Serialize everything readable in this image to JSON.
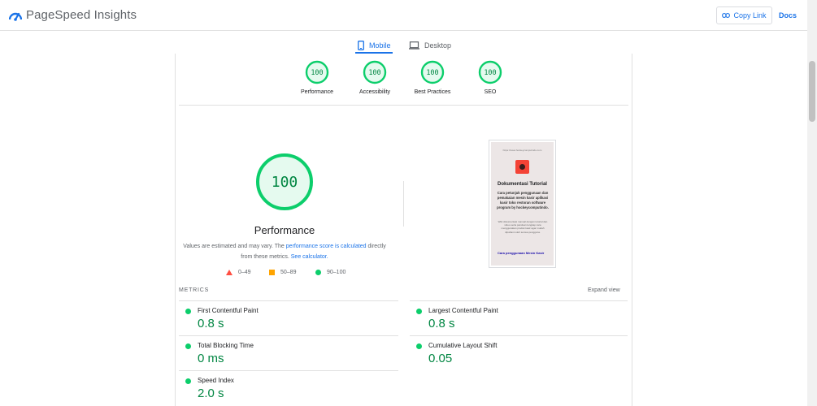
{
  "header": {
    "title": "PageSpeed Insights",
    "copy_link_label": "Copy Link",
    "docs_label": "Docs"
  },
  "tabs": [
    {
      "label": "Mobile",
      "active": true
    },
    {
      "label": "Desktop",
      "active": false
    }
  ],
  "category_scores": [
    {
      "label": "Performance",
      "score": "100"
    },
    {
      "label": "Accessibility",
      "score": "100"
    },
    {
      "label": "Best Practices",
      "score": "100"
    },
    {
      "label": "SEO",
      "score": "100"
    }
  ],
  "performance": {
    "score": "100",
    "title": "Performance",
    "desc_prefix": "Values are estimated and may vary. The ",
    "desc_link1": "performance score is calculated",
    "desc_middle": " directly from these metrics. ",
    "desc_link2": "See calculator."
  },
  "legend": [
    {
      "range": "0–49",
      "color": "#ff4e42"
    },
    {
      "range": "50–89",
      "color": "#ffa400"
    },
    {
      "range": "90–100",
      "color": "#0cce6b"
    }
  ],
  "screenshot": {
    "url": "https://www.hockeycomputindo.com",
    "heading": "Dokumentasi Tutorial",
    "subheading": "Cara petunjuk penggunaan dan pemakaian mesin kasir aplikasi kasir toko restoran software program by hockeycomputindo.",
    "body": "Wiki dokumentasi manual dengan tutorial dan video serta panduan lengkap cara menggunakan produk kasir agar mudah dipahami oleh semua pengguna.",
    "link": "Cara penggunaan Mesin Kasir"
  },
  "metrics": {
    "title": "METRICS",
    "expand_label": "Expand view",
    "items": [
      {
        "label": "First Contentful Paint",
        "value": "0.8 s"
      },
      {
        "label": "Largest Contentful Paint",
        "value": "0.8 s"
      },
      {
        "label": "Total Blocking Time",
        "value": "0 ms"
      },
      {
        "label": "Cumulative Layout Shift",
        "value": "0.05"
      },
      {
        "label": "Speed Index",
        "value": "2.0 s"
      }
    ]
  },
  "colors": {
    "pass": "#0cce6b",
    "pass_text": "#018642",
    "link": "#1a73e8"
  }
}
